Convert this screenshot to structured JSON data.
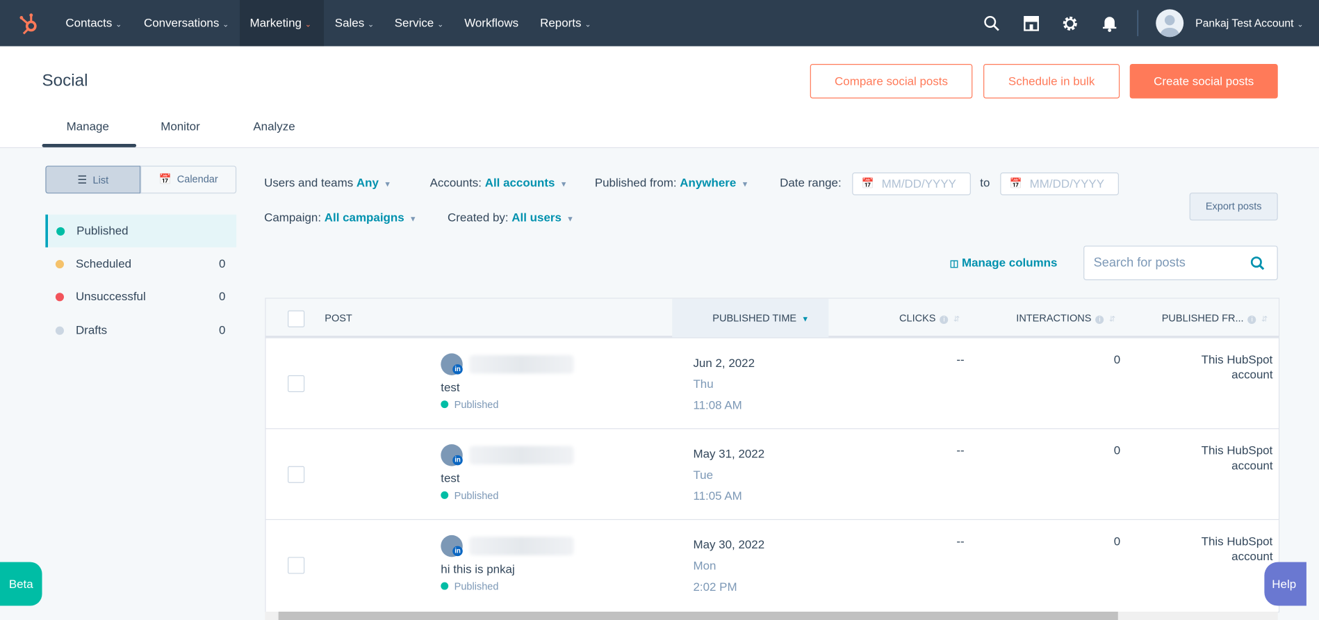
{
  "nav": {
    "items": [
      {
        "label": "Contacts",
        "dropdown": true
      },
      {
        "label": "Conversations",
        "dropdown": true
      },
      {
        "label": "Marketing",
        "dropdown": true,
        "active": true
      },
      {
        "label": "Sales",
        "dropdown": true
      },
      {
        "label": "Service",
        "dropdown": true
      },
      {
        "label": "Workflows",
        "dropdown": false
      },
      {
        "label": "Reports",
        "dropdown": true
      }
    ],
    "account_name": "Pankaj Test Account",
    "icons": [
      "search-icon",
      "marketplace-icon",
      "gear-icon",
      "bell-icon"
    ]
  },
  "header": {
    "title": "Social",
    "compare_label": "Compare social posts",
    "schedule_label": "Schedule in bulk",
    "create_label": "Create social posts",
    "tabs": [
      "Manage",
      "Monitor",
      "Analyze"
    ],
    "active_tab": "Manage"
  },
  "view_toggle": {
    "list": "List",
    "calendar": "Calendar",
    "active": "List"
  },
  "sidebar": {
    "items": [
      {
        "label": "Published",
        "count": "",
        "color": "#00bda5",
        "active": true
      },
      {
        "label": "Scheduled",
        "count": "0",
        "color": "#f5c26b"
      },
      {
        "label": "Unsuccessful",
        "count": "0",
        "color": "#f2545b"
      },
      {
        "label": "Drafts",
        "count": "0",
        "color": "#cbd6e2"
      }
    ]
  },
  "filters": {
    "users_label": "Users and teams",
    "users_value": "Any",
    "accounts_label": "Accounts:",
    "accounts_value": "All accounts",
    "published_from_label": "Published from:",
    "published_from_value": "Anywhere",
    "date_range_label": "Date range:",
    "date_from_placeholder": "MM/DD/YYYY",
    "to_label": "to",
    "date_to_placeholder": "MM/DD/YYYY",
    "campaign_label": "Campaign:",
    "campaign_value": "All campaigns",
    "created_by_label": "Created by:",
    "created_by_value": "All users"
  },
  "export_label": "Export posts",
  "manage_columns_label": "Manage columns",
  "search_placeholder": "Search for posts",
  "table": {
    "columns": [
      "POST",
      "PUBLISHED TIME",
      "CLICKS",
      "INTERACTIONS",
      "PUBLISHED FR..."
    ],
    "rows": [
      {
        "text": "test",
        "status": "Published",
        "date": "Jun 2, 2022",
        "day": "Thu",
        "time": "11:08 AM",
        "clicks": "--",
        "interactions": "0",
        "from1": "This HubSpot",
        "from2": "account"
      },
      {
        "text": "test",
        "status": "Published",
        "date": "May 31, 2022",
        "day": "Tue",
        "time": "11:05 AM",
        "clicks": "--",
        "interactions": "0",
        "from1": "This HubSpot",
        "from2": "account"
      },
      {
        "text": "hi this is pnkaj",
        "status": "Published",
        "date": "May 30, 2022",
        "day": "Mon",
        "time": "2:02 PM",
        "clicks": "--",
        "interactions": "0",
        "from1": "This HubSpot",
        "from2": "account"
      }
    ]
  },
  "beta_label": "Beta",
  "help_label": "Help",
  "colors": {
    "nav": "#2d3e50",
    "accent": "#ff7a59",
    "link": "#0091ae",
    "published": "#00bda5",
    "help": "#6a78d1"
  }
}
